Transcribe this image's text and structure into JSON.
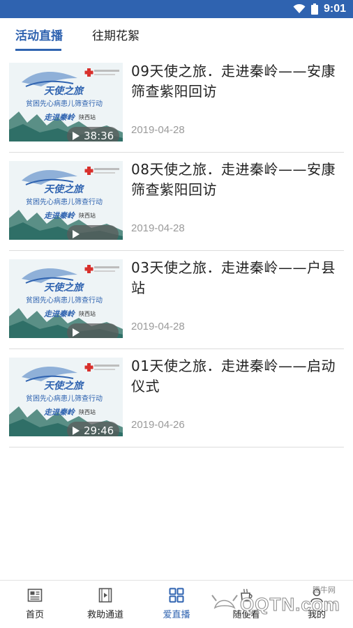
{
  "status_bar": {
    "time": "9:01"
  },
  "tabs": [
    {
      "label": "活动直播",
      "active": true
    },
    {
      "label": "往期花絮",
      "active": false
    }
  ],
  "items": [
    {
      "title": "09天使之旅．走进秦岭——安康筛查紫阳回访",
      "date": "2019-04-28",
      "duration": "38:36"
    },
    {
      "title": "08天使之旅．走进秦岭——安康筛查紫阳回访",
      "date": "2019-04-28",
      "duration": ""
    },
    {
      "title": "03天使之旅．走进秦岭——户县站",
      "date": "2019-04-28",
      "duration": ""
    },
    {
      "title": "01天使之旅．走进秦岭——启动仪式",
      "date": "2019-04-26",
      "duration": "29:46"
    }
  ],
  "thumbnail": {
    "headline": "天使之旅",
    "subtitle": "贫困先心病患儿筛查行动",
    "tagline": "走进秦岭",
    "region": "陕西站"
  },
  "bottom_nav": [
    {
      "label": "首页",
      "icon": "newspaper-icon",
      "active": false
    },
    {
      "label": "救助通道",
      "icon": "video-doc-icon",
      "active": false
    },
    {
      "label": "爱直播",
      "icon": "grid-icon",
      "active": true
    },
    {
      "label": "随便看",
      "icon": "cup-icon",
      "active": false
    },
    {
      "label": "我的",
      "icon": "person-icon",
      "active": false
    }
  ],
  "watermark": {
    "text": "QQTN.com",
    "sub": "腾牛网"
  },
  "colors": {
    "primary": "#2f63b0",
    "divider": "#dcdcdc",
    "date": "#9a9a9a"
  }
}
